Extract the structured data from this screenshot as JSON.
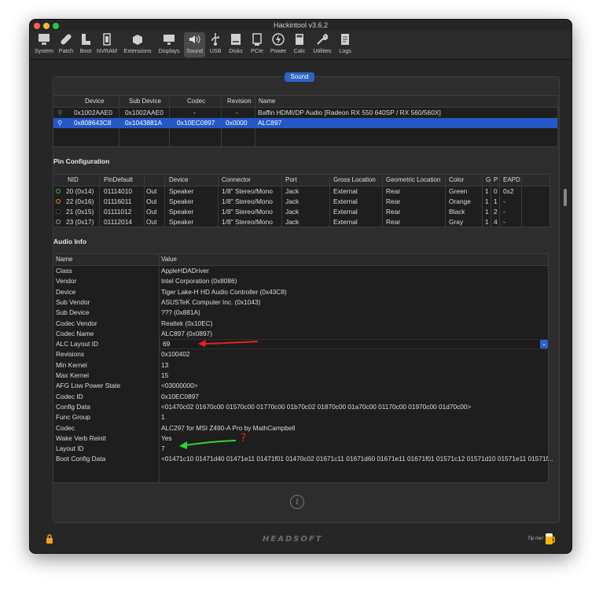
{
  "window": {
    "title": "Hackintool v3.6.2"
  },
  "toolbar": [
    {
      "label": "System",
      "icon": "monitor-icon"
    },
    {
      "label": "Patch",
      "icon": "bandage-icon"
    },
    {
      "label": "Boot",
      "icon": "boot-icon"
    },
    {
      "label": "NVRAM",
      "icon": "chip-icon"
    },
    {
      "label": "Extensions",
      "icon": "box-icon"
    },
    {
      "label": "Displays",
      "icon": "display-icon"
    },
    {
      "label": "Sound",
      "icon": "speaker-icon"
    },
    {
      "label": "USB",
      "icon": "usb-icon"
    },
    {
      "label": "Disks",
      "icon": "disk-icon"
    },
    {
      "label": "PCIe",
      "icon": "pcie-icon"
    },
    {
      "label": "Power",
      "icon": "power-icon"
    },
    {
      "label": "Calc",
      "icon": "calculator-icon"
    },
    {
      "label": "Utilities",
      "icon": "wrench-icon"
    },
    {
      "label": "Logs",
      "icon": "logs-icon"
    }
  ],
  "tab": {
    "label": "Sound"
  },
  "devices": {
    "headers": [
      "Device",
      "Sub Device",
      "Codec",
      "Revision",
      "Name"
    ],
    "rows": [
      [
        "0x1002AAE0",
        "0x1002AAE0",
        "-",
        "-",
        "Baffin HDMI/DP Audio [Radeon RX 550 640SP / RX 560/560X]"
      ],
      [
        "0x808643C8",
        "0x1043881A",
        "0x10EC0897",
        "0x0000",
        "ALC897"
      ]
    ]
  },
  "pin_config": {
    "title": "Pin Configuration",
    "headers": [
      "NID",
      "PinDefault",
      "",
      "Device",
      "Connector",
      "Port",
      "Gross Location",
      "Geometric Location",
      "Color",
      "G",
      "P",
      "EAPD"
    ],
    "rows": [
      {
        "dot_color": "#3cc23c",
        "cells": [
          "20 (0x14)",
          "01114010",
          "Out",
          "Speaker",
          "1/8\" Stereo/Mono",
          "Jack",
          "External",
          "Rear",
          "Green",
          "1",
          "0",
          "0x2"
        ]
      },
      {
        "dot_color": "#e8852b",
        "cells": [
          "22 (0x16)",
          "01116011",
          "Out",
          "Speaker",
          "1/8\" Stereo/Mono",
          "Jack",
          "External",
          "Rear",
          "Orange",
          "1",
          "1",
          "-"
        ]
      },
      {
        "dot_color": "#000000",
        "cells": [
          "21 (0x15)",
          "01111012",
          "Out",
          "Speaker",
          "1/8\" Stereo/Mono",
          "Jack",
          "External",
          "Rear",
          "Black",
          "1",
          "2",
          "-"
        ]
      },
      {
        "dot_color": "#9a9a9a",
        "cells": [
          "23 (0x17)",
          "01112014",
          "Out",
          "Speaker",
          "1/8\" Stereo/Mono",
          "Jack",
          "External",
          "Rear",
          "Gray",
          "1",
          "4",
          "-"
        ]
      }
    ]
  },
  "audio_info": {
    "title": "Audio Info",
    "headers": [
      "Name",
      "Value"
    ],
    "rows": [
      [
        "Class",
        "AppleHDADriver"
      ],
      [
        "Vendor",
        "Intel Corporation (0x8086)"
      ],
      [
        "Device",
        "Tiger Lake-H HD Audio Controller (0x43C8)"
      ],
      [
        "Sub Vendor",
        "ASUSTeK Computer Inc. (0x1043)"
      ],
      [
        "Sub Device",
        "??? (0x881A)"
      ],
      [
        "Codec Vendor",
        "Realtek (0x10EC)"
      ],
      [
        "Codec Name",
        "ALC897 (0x0897)"
      ],
      [
        "ALC Layout ID",
        "69"
      ],
      [
        "Revisions",
        "0x100402"
      ],
      [
        "Min Kernel",
        "13"
      ],
      [
        "Max Kernel",
        "15"
      ],
      [
        "AFG Low Power State",
        "<03000000>"
      ],
      [
        "Codec ID",
        "0x10EC0897"
      ],
      [
        "Config Data",
        "<01470c02 01670c00 01570c00 01770c00 01b70c02 01870c00 01a70c00 01170c00 01970c00 01d70c00>"
      ],
      [
        "Func Group",
        "1"
      ],
      [
        "Codec",
        "ALC297 for MSI Z490-A Pro by MathCampbell"
      ],
      [
        "Wake Verb Reinit",
        "Yes"
      ],
      [
        "Layout ID",
        "7"
      ],
      [
        "Boot Config Data",
        "<01471c10 01471d40 01471e11 01471f01 01470c02 01671c11 01671d60 01671e11 01671f01 01571c12 01571d10 01571e11 01571f..."
      ]
    ]
  },
  "annotations": {
    "question_mark": "?"
  },
  "footer": {
    "logo": "HEADSOFT",
    "tip": "Tip me!"
  },
  "colors": {
    "accent": "#2458c7",
    "annotation_red": "#e32222",
    "annotation_green": "#2fd62f"
  }
}
